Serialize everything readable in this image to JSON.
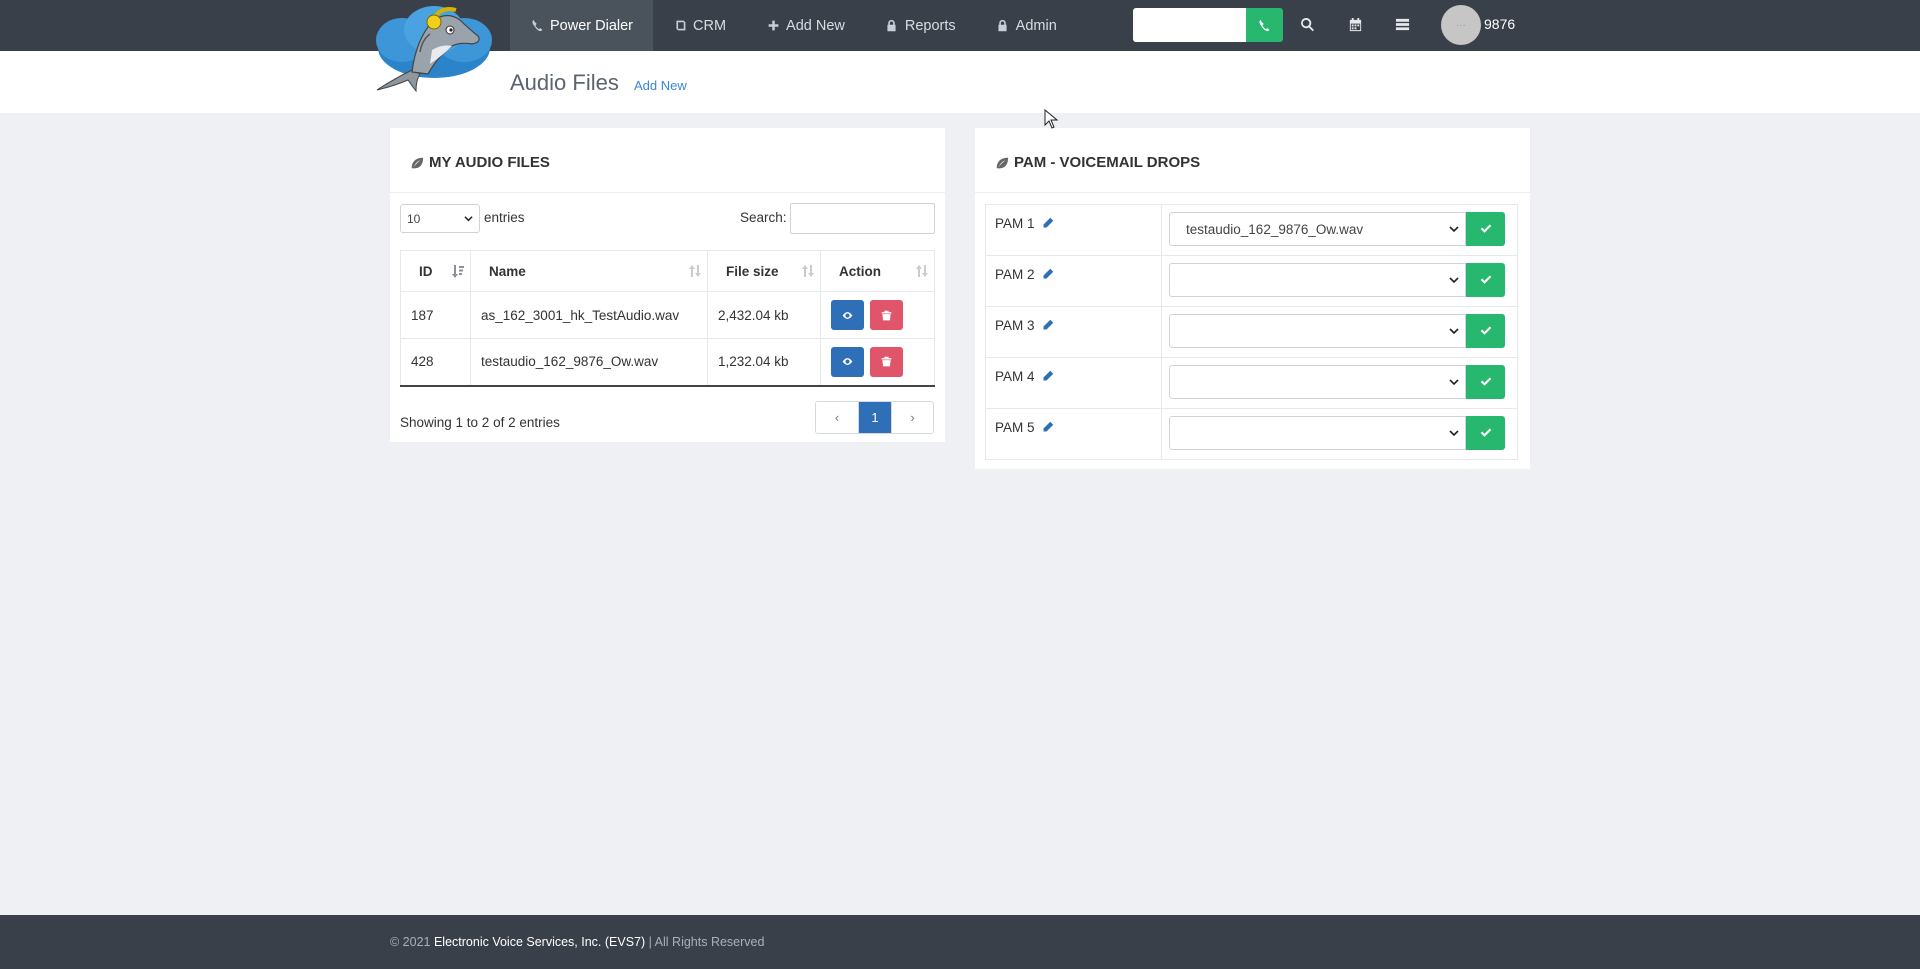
{
  "nav": {
    "items": [
      {
        "label": "Power Dialer",
        "icon": "phone-icon",
        "active": true
      },
      {
        "label": "CRM",
        "icon": "book-icon",
        "active": false
      },
      {
        "label": "Add New",
        "icon": "plus-icon",
        "active": false
      },
      {
        "label": "Reports",
        "icon": "lock-icon",
        "active": false
      },
      {
        "label": "Admin",
        "icon": "lock-icon",
        "active": false
      }
    ],
    "dial_value": "",
    "user_ext": "9876",
    "avatar_text": "···"
  },
  "header": {
    "title": "Audio Files",
    "add_link": "Add New"
  },
  "audio_files": {
    "title": "MY AUDIO FILES",
    "length_value": "10",
    "length_label": "entries",
    "search_label": "Search:",
    "search_value": "",
    "columns": [
      "ID",
      "Name",
      "File size",
      "Action"
    ],
    "rows": [
      {
        "id": "187",
        "name": "as_162_3001_hk_TestAudio.wav",
        "size": "2,432.04 kb"
      },
      {
        "id": "428",
        "name": "testaudio_162_9876_Ow.wav",
        "size": "1,232.04 kb"
      }
    ],
    "showing": "Showing 1 to 2 of 2 entries",
    "pager": {
      "prev": "‹",
      "current": "1",
      "next": "›"
    }
  },
  "pam": {
    "title": "PAM - VOICEMAIL DROPS",
    "rows": [
      {
        "label": "PAM 1",
        "value": "testaudio_162_9876_Ow.wav"
      },
      {
        "label": "PAM 2",
        "value": ""
      },
      {
        "label": "PAM 3",
        "value": ""
      },
      {
        "label": "PAM 4",
        "value": ""
      },
      {
        "label": "PAM 5",
        "value": ""
      }
    ]
  },
  "footer": {
    "prefix": "© 2021 ",
    "company": "Electronic Voice Services, Inc. (EVS7)",
    "suffix": " | All Rights Reserved"
  },
  "colors": {
    "topbar": "#3a4049",
    "accent_green": "#27b76e",
    "accent_blue": "#2f6fb7",
    "danger": "#e0556a",
    "link": "#3b86d8"
  }
}
